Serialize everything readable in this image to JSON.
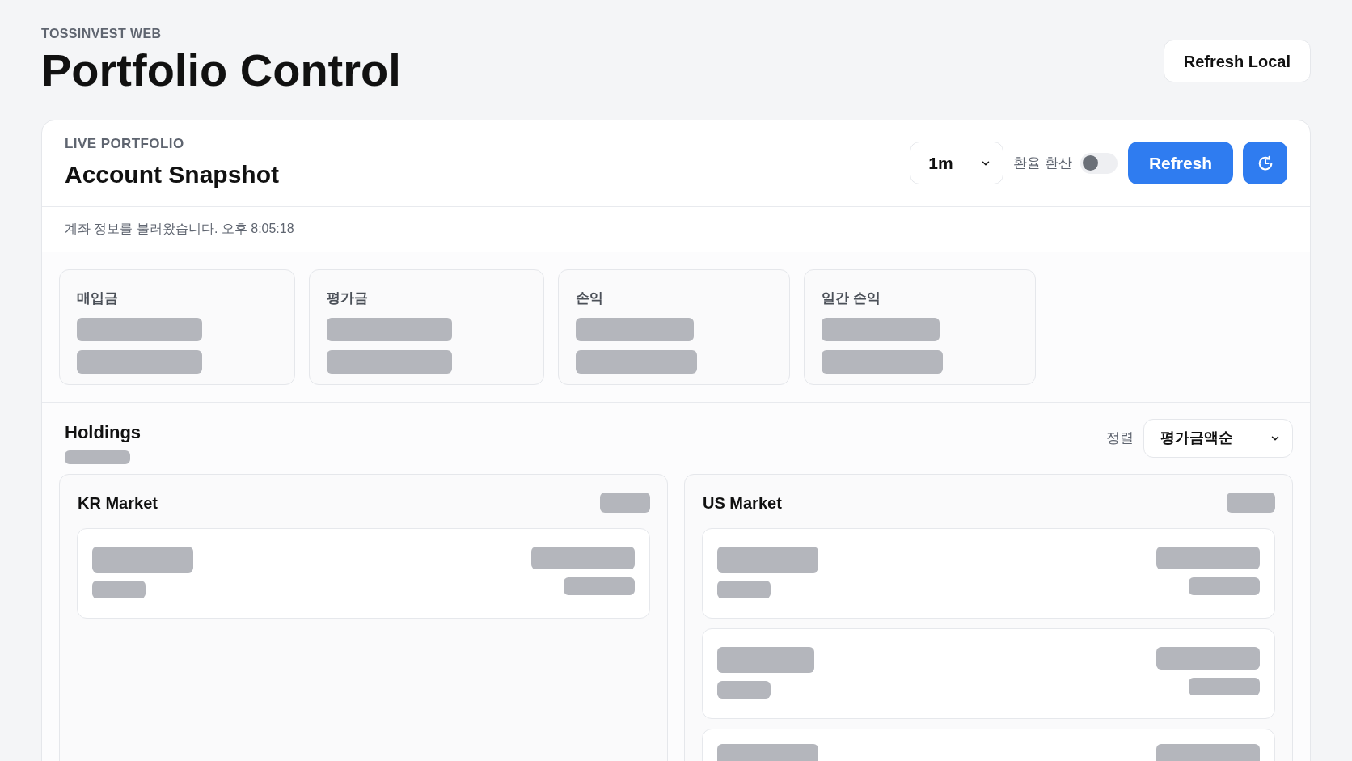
{
  "header": {
    "eyebrow": "TOSSINVEST WEB",
    "title": "Portfolio Control",
    "action": "Refresh Local"
  },
  "snapshot": {
    "eyebrow": "LIVE PORTFOLIO",
    "title": "Account Snapshot",
    "interval": "1m",
    "fx_toggle": {
      "label": "환율 환산",
      "on": false
    },
    "refresh": "Refresh",
    "status": "계좌 정보를 불러왔습니다. 오후 8:05:18",
    "stats": [
      {
        "label": "매입금",
        "loading": true
      },
      {
        "label": "평가금",
        "loading": true
      },
      {
        "label": "손익",
        "loading": true
      },
      {
        "label": "일간 손익",
        "loading": true
      }
    ]
  },
  "holdings": {
    "title": "Holdings",
    "loading": true,
    "sort_label": "정렬",
    "sort_value": "평가금액순",
    "markets": [
      {
        "name": "KR Market",
        "loading": true,
        "rows": [
          {
            "kind": "placeholder"
          }
        ]
      },
      {
        "name": "US Market",
        "loading": true,
        "rows": [
          {
            "kind": "placeholder"
          },
          {
            "kind": "placeholder"
          },
          {
            "kind": "placeholder"
          }
        ]
      }
    ]
  }
}
